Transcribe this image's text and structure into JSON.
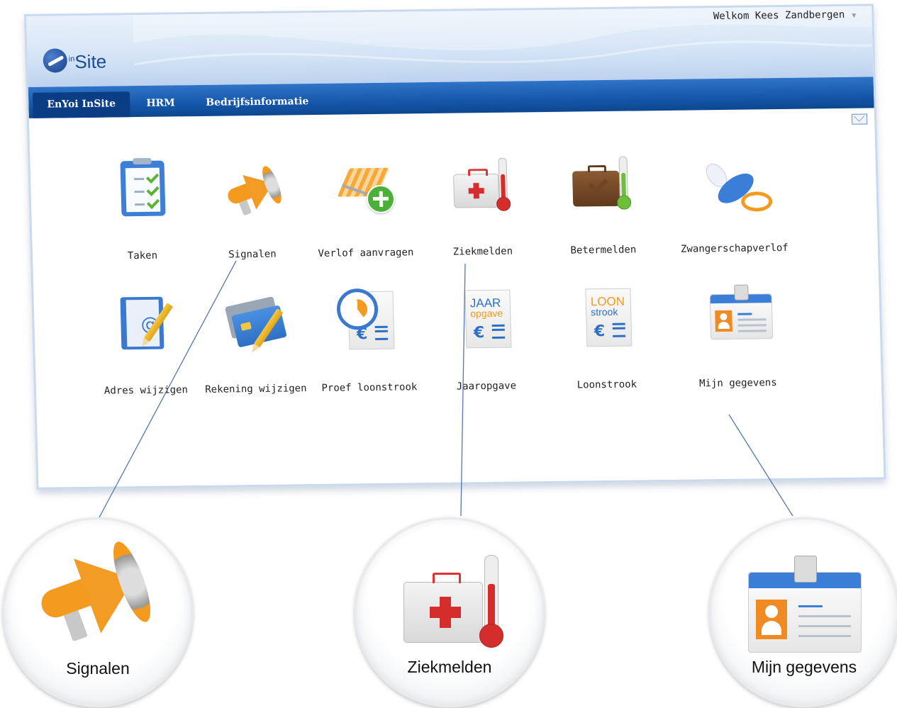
{
  "header": {
    "logo_text": "Site",
    "logo_superscript": "in",
    "welcome": "Welkom Kees Zandbergen"
  },
  "nav": {
    "tabs": [
      {
        "label": "EnYoi InSite",
        "active": true
      },
      {
        "label": "HRM",
        "active": false
      },
      {
        "label": "Bedrijfsinformatie",
        "active": false
      }
    ]
  },
  "tiles_row1": [
    {
      "label": "Taken",
      "icon": "clipboard-checklist-icon"
    },
    {
      "label": "Signalen",
      "icon": "megaphone-icon"
    },
    {
      "label": "Verlof aanvragen",
      "icon": "beach-chair-add-icon"
    },
    {
      "label": "Ziekmelden",
      "icon": "first-aid-thermometer-icon"
    },
    {
      "label": "Betermelden",
      "icon": "briefcase-thermometer-icon"
    },
    {
      "label": "Zwangerschapverlof",
      "icon": "pacifier-icon"
    }
  ],
  "tiles_row2": [
    {
      "label": "Adres wijzigen",
      "icon": "address-book-edit-icon"
    },
    {
      "label": "Rekening wijzigen",
      "icon": "bank-card-edit-icon"
    },
    {
      "label": "Proef loonstrook",
      "icon": "clock-document-icon"
    },
    {
      "label": "Jaaropgave",
      "icon": "annual-statement-icon",
      "doc_line1": "JAAR",
      "doc_line2": "opgave"
    },
    {
      "label": "Loonstrook",
      "icon": "payslip-icon",
      "doc_line1": "LOON",
      "doc_line2": "strook"
    },
    {
      "label": "Mijn gegevens",
      "icon": "id-badge-icon"
    }
  ],
  "doc_symbol": "€",
  "zoom": [
    {
      "label": "Signalen",
      "icon": "megaphone-icon"
    },
    {
      "label": "Ziekmelden",
      "icon": "first-aid-thermometer-icon"
    },
    {
      "label": "Mijn  gegevens",
      "icon": "id-badge-icon"
    }
  ],
  "colors": {
    "nav_blue": "#1657aa",
    "accent_orange": "#f39a1f",
    "callout_line": "#5577aa"
  }
}
